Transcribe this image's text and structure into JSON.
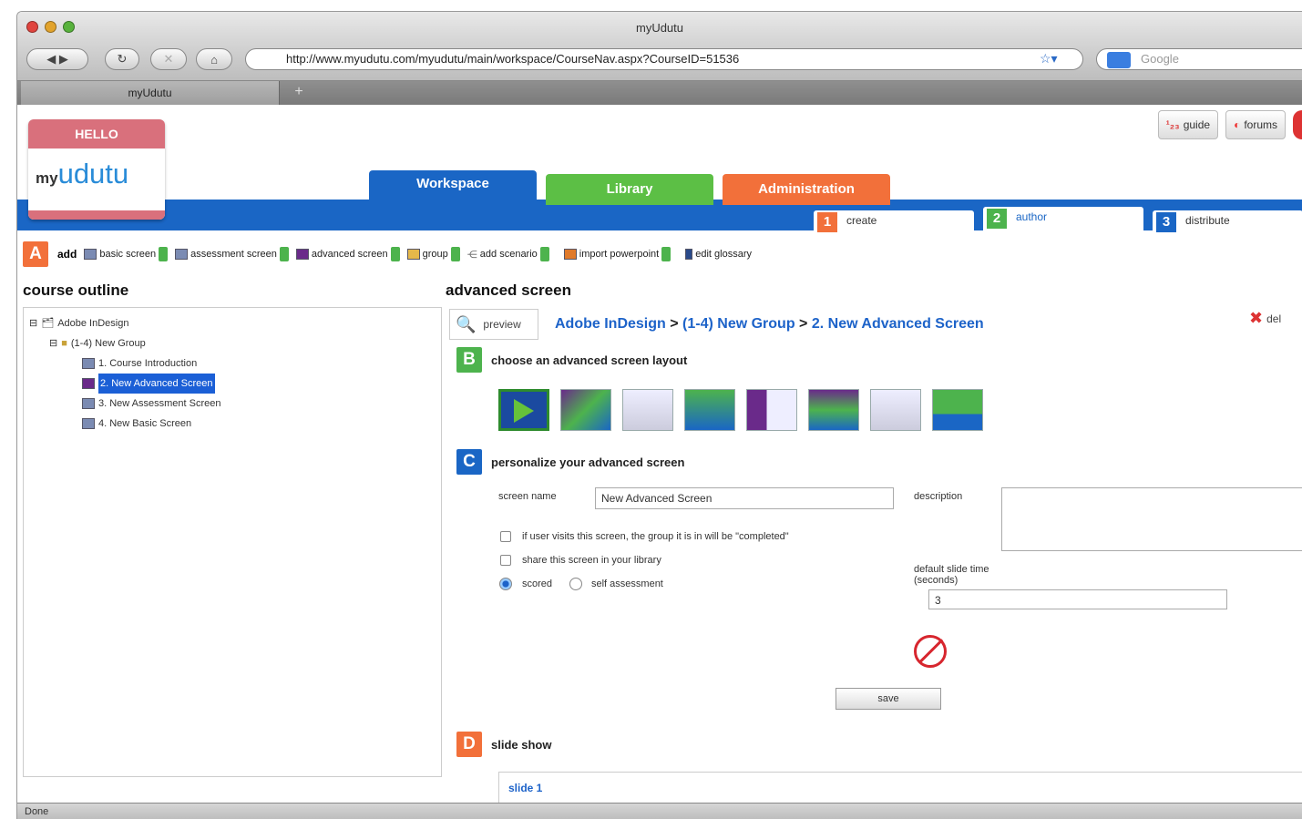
{
  "window": {
    "title": "myUdutu"
  },
  "toolbar": {
    "url": "http://www.myudutu.com/myudutu/main/workspace/CourseNav.aspx?CourseID=51536",
    "search_placeholder": "Google"
  },
  "tabs": [
    {
      "label": "myUdutu"
    }
  ],
  "brand": {
    "hello": "HELLO",
    "my": "my",
    "name": "udutu"
  },
  "top_links": {
    "guide": "guide",
    "forums": "forums"
  },
  "main_tabs": [
    {
      "label": "Workspace",
      "color": "#1a66c5"
    },
    {
      "label": "Library",
      "color": "#5cbf45"
    },
    {
      "label": "Administration",
      "color": "#f2703a"
    }
  ],
  "steps": [
    {
      "num": "1",
      "label": "create",
      "color": "#f2703a"
    },
    {
      "num": "2",
      "label": "author",
      "color": "#4db34d"
    },
    {
      "num": "3",
      "label": "distribute",
      "color": "#1a66c5"
    }
  ],
  "addbar": {
    "letter": "A",
    "label": "add",
    "items": [
      "basic screen",
      "assessment screen",
      "advanced screen",
      "group",
      "add scenario",
      "import powerpoint",
      "edit glossary"
    ]
  },
  "outline": {
    "title": "course outline",
    "nodes": [
      {
        "label": "Adobe InDesign",
        "level": 0
      },
      {
        "label": "(1-4) New Group",
        "level": 1
      },
      {
        "label": "1. Course Introduction",
        "level": 2
      },
      {
        "label": "2. New Advanced Screen",
        "level": 2,
        "selected": true
      },
      {
        "label": "3. New Assessment Screen",
        "level": 2
      },
      {
        "label": "4. New Basic Screen",
        "level": 2
      }
    ]
  },
  "advanced": {
    "title": "advanced screen",
    "preview": "preview",
    "breadcrumb": [
      "Adobe InDesign",
      "(1-4) New Group",
      "2. New Advanced Screen"
    ],
    "delete": "del"
  },
  "sections": {
    "B": {
      "letter": "B",
      "title": "choose an advanced screen layout",
      "color": "#4db34d"
    },
    "C": {
      "letter": "C",
      "title": "personalize your advanced screen",
      "color": "#1a66c5"
    },
    "D": {
      "letter": "D",
      "title": "slide show",
      "color": "#f2703a"
    }
  },
  "form": {
    "screen_name_label": "screen name",
    "screen_name_value": "New Advanced Screen",
    "description_label": "description",
    "visit_label": "if user visits this screen, the group it is in will be \"completed\"",
    "share_label": "share this screen in your library",
    "scored_label": "scored",
    "self_label": "self assessment",
    "slide_time_label": "default slide time (seconds)",
    "slide_time_value": "3",
    "save_label": "save"
  },
  "slideshow": {
    "first": "slide 1"
  },
  "status": "Done"
}
